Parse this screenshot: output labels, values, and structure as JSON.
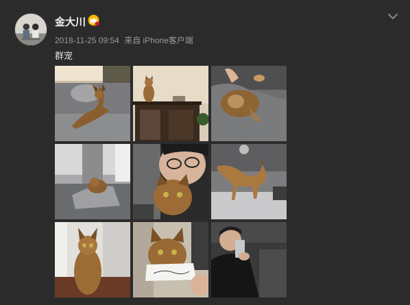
{
  "post": {
    "username": "金大川",
    "timestamp": "2018-11-25 09:54",
    "source": "来自 iPhone客户端",
    "text": "群宠",
    "badge_icon": "vip-crown-icon",
    "menu_icon": "chevron-down-icon"
  },
  "photos": [
    {
      "name": "photo-cat-on-sofa"
    },
    {
      "name": "photo-cat-on-cabinet"
    },
    {
      "name": "photo-cat-upside-down"
    },
    {
      "name": "photo-cat-in-blanket"
    },
    {
      "name": "photo-man-with-cat-selfie"
    },
    {
      "name": "photo-cat-walking-on-couch"
    },
    {
      "name": "photo-cat-sitting-floor"
    },
    {
      "name": "photo-cat-with-paper"
    },
    {
      "name": "photo-man-mirror-selfie"
    }
  ],
  "colors": {
    "background": "#2b2b2b",
    "username": "#f0f0f0",
    "meta": "#9a9a9a"
  }
}
